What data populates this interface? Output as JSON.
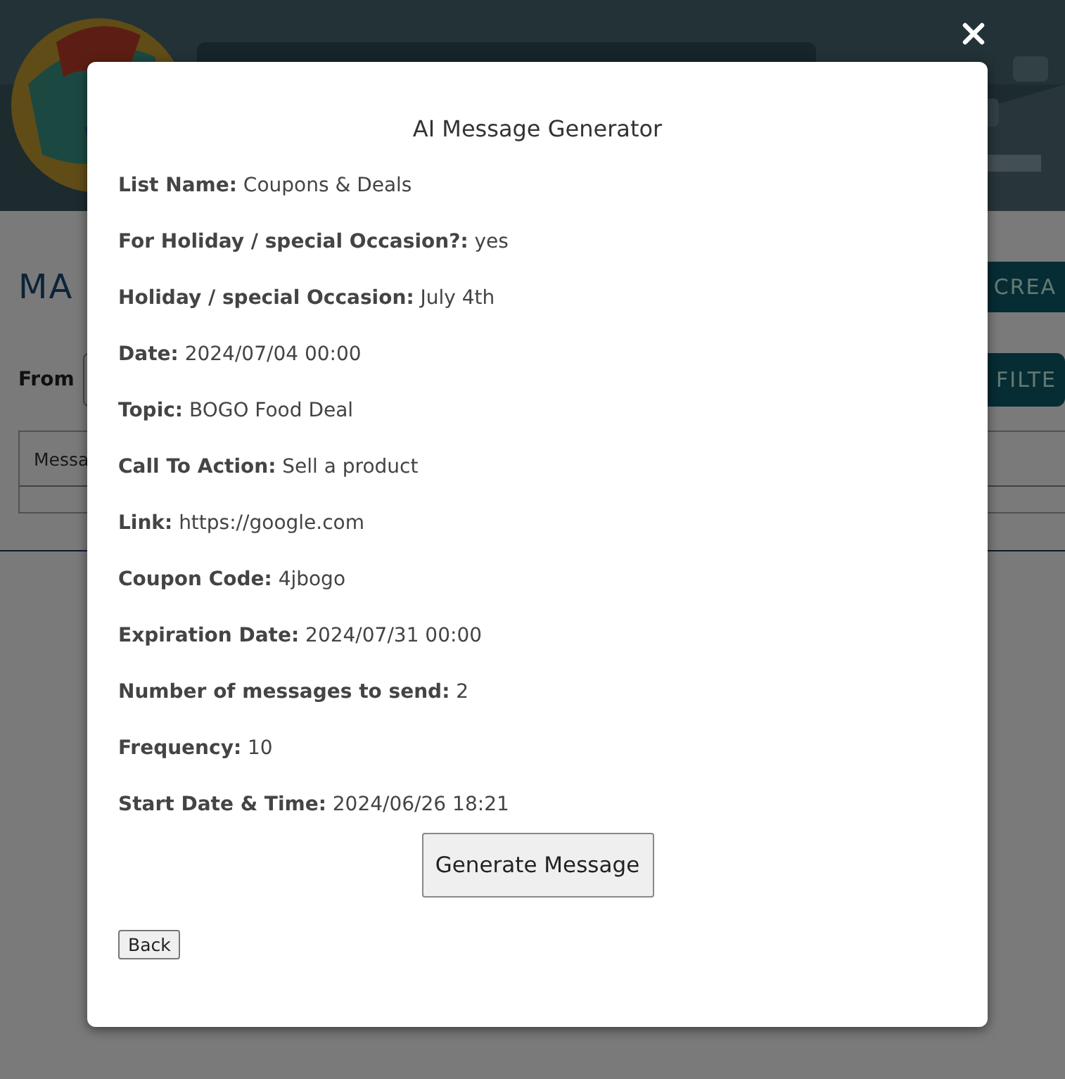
{
  "page": {
    "heading": "MA",
    "create_button": "CREA",
    "from_label": "From",
    "filter_button": "FILTE",
    "table": {
      "columns": [
        "Messa"
      ]
    }
  },
  "dialog": {
    "title": "AI Message Generator",
    "fields": [
      {
        "label": "List Name:",
        "value": "Coupons & Deals"
      },
      {
        "label": "For Holiday / special Occasion?:",
        "value": "yes"
      },
      {
        "label": "Holiday / special Occasion:",
        "value": "July 4th"
      },
      {
        "label": "Date:",
        "value": "2024/07/04 00:00"
      },
      {
        "label": "Topic:",
        "value": "BOGO Food Deal"
      },
      {
        "label": "Call To Action:",
        "value": "Sell a product"
      },
      {
        "label": "Link:",
        "value": "https://google.com"
      },
      {
        "label": "Coupon Code:",
        "value": "4jbogo"
      },
      {
        "label": "Expiration Date:",
        "value": "2024/07/31 00:00"
      },
      {
        "label": "Number of messages to send:",
        "value": "2"
      },
      {
        "label": "Frequency:",
        "value": "10"
      },
      {
        "label": "Start Date & Time:",
        "value": "2024/06/26 18:21"
      }
    ],
    "generate_button": "Generate Message",
    "back_button": "Back"
  }
}
